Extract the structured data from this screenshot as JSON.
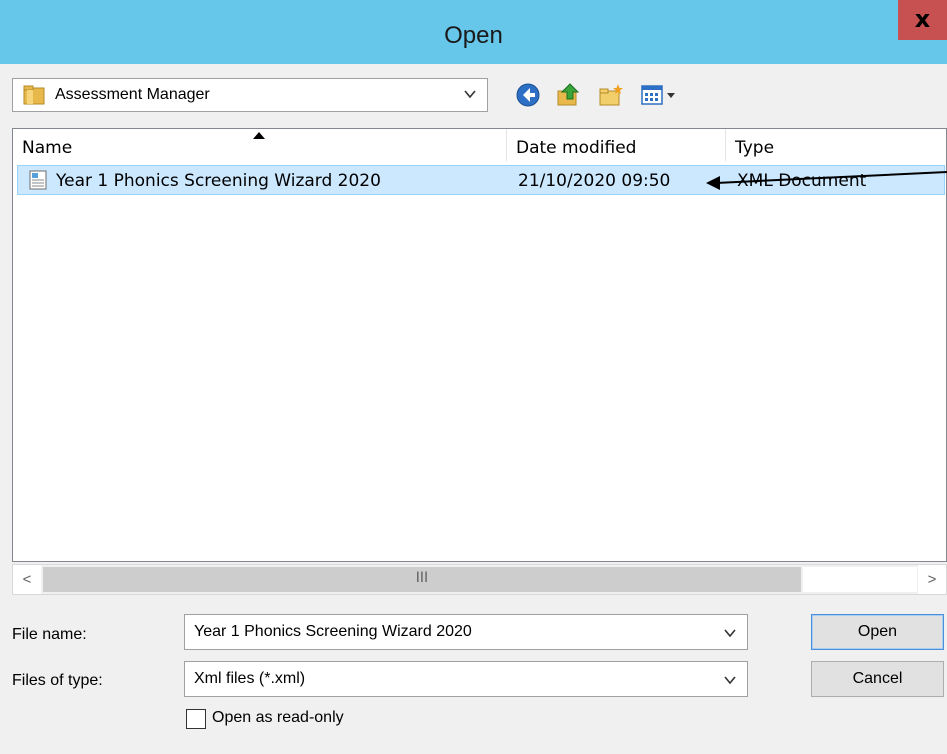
{
  "window": {
    "title": "Open",
    "close_glyph": "x"
  },
  "look_in": {
    "value": "Assessment Manager"
  },
  "toolbar": {
    "icons": [
      "back-icon",
      "up-folder-icon",
      "new-folder-icon",
      "view-menu-icon"
    ]
  },
  "file_list": {
    "columns": [
      "Name",
      "Date modified",
      "Type"
    ],
    "rows": [
      {
        "name": "Year 1 Phonics Screening Wizard 2020",
        "date_modified": "21/10/2020 09:50",
        "type": "XML Document"
      }
    ]
  },
  "scrollbar": {
    "left_glyph": "<",
    "right_glyph": ">",
    "grip_glyph": "III"
  },
  "form": {
    "file_name_label": "File name:",
    "file_name_value": "Year 1 Phonics Screening Wizard 2020",
    "file_type_label": "Files of type:",
    "file_type_value": "Xml files (*.xml)",
    "read_only_label": "Open as read-only",
    "read_only_checked": false
  },
  "buttons": {
    "open": "Open",
    "cancel": "Cancel"
  },
  "colors": {
    "titlebar": "#67c7ea",
    "close": "#c75050",
    "selection": "#cce8ff"
  }
}
